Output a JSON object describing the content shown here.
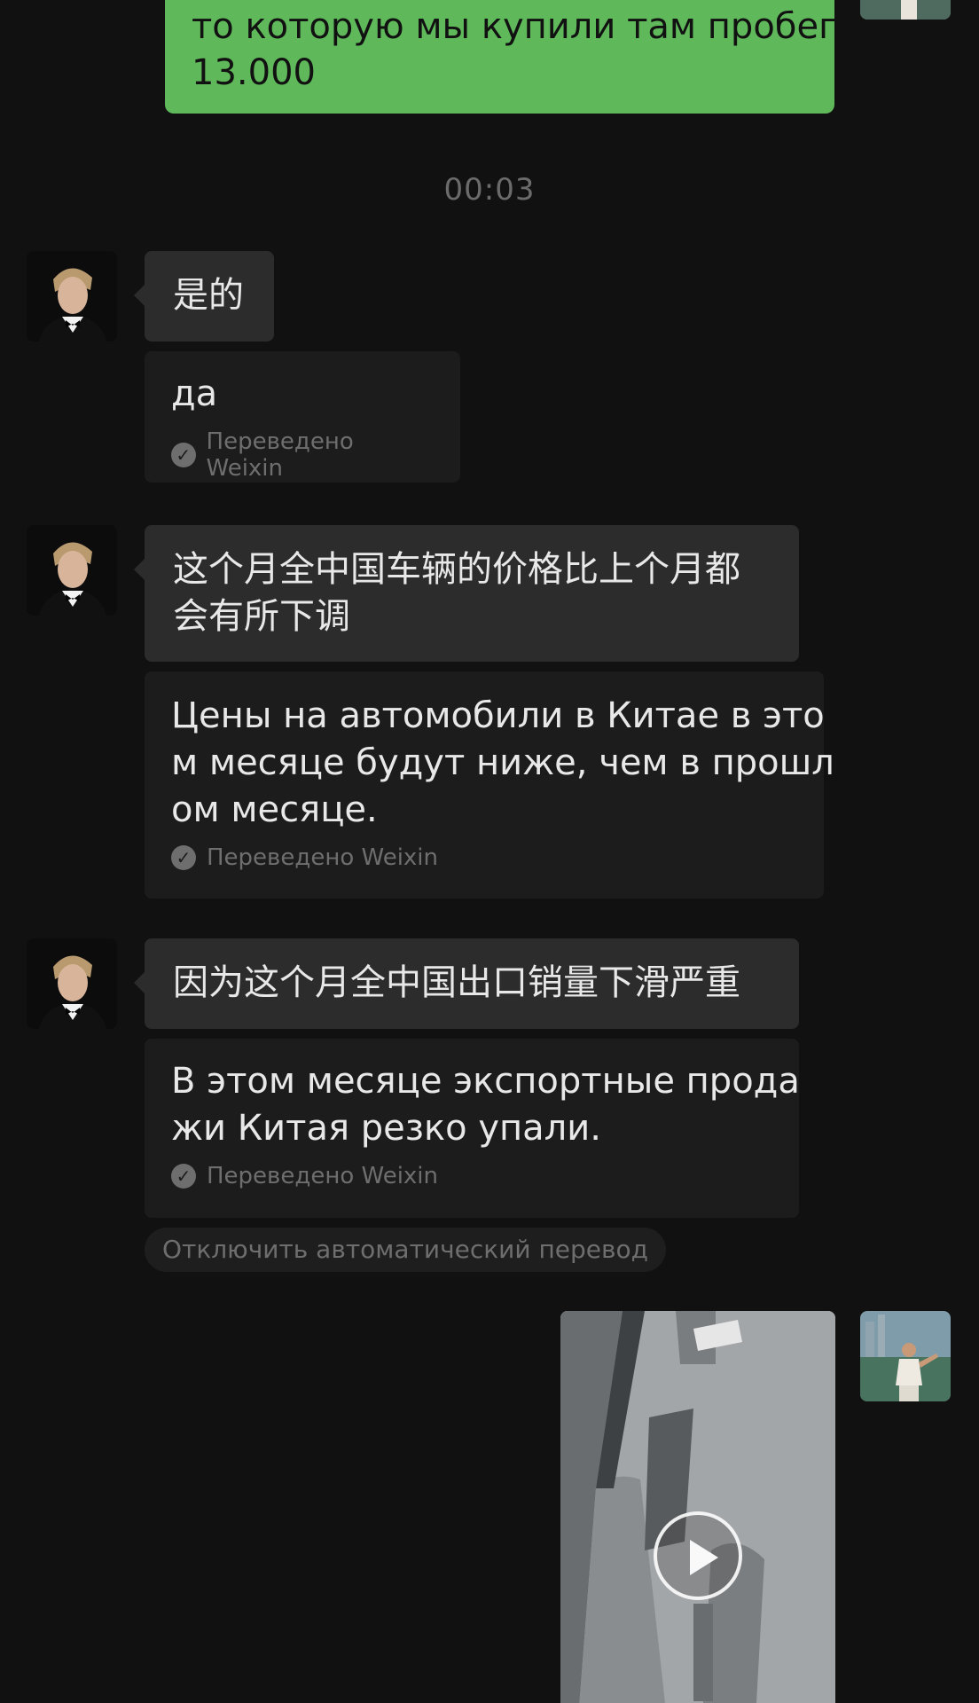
{
  "colors": {
    "background": "#111111",
    "outgoing_bubble": "#5fb85a",
    "incoming_bubble": "#2c2c2c",
    "translation_bubble": "#1c1c1c",
    "muted_text": "#6e6e6e"
  },
  "messages": {
    "outgoing_top": {
      "lines": [
        "то которую мы купили там пробег",
        "13.000"
      ]
    },
    "timestamp": "00:03",
    "incoming": [
      {
        "original": [
          "是的"
        ],
        "translation": [
          "да"
        ],
        "translated_by": "Переведено Weixin"
      },
      {
        "original": [
          "这个月全中国车辆的价格比上个月都",
          "会有所下调"
        ],
        "translation": [
          "Цены на автомобили в Китае в это",
          "м месяце будут ниже, чем в прошл",
          "ом месяце."
        ],
        "translated_by": "Переведено Weixin"
      },
      {
        "original": [
          "因为这个月全中国出口销量下滑严重"
        ],
        "translation": [
          "В этом месяце экспортные прода",
          "жи Китая резко упали."
        ],
        "translated_by": "Переведено Weixin"
      }
    ],
    "auto_translate_off": "Отключить автоматический перевод",
    "outgoing_video": {
      "icon": "play-icon"
    }
  }
}
